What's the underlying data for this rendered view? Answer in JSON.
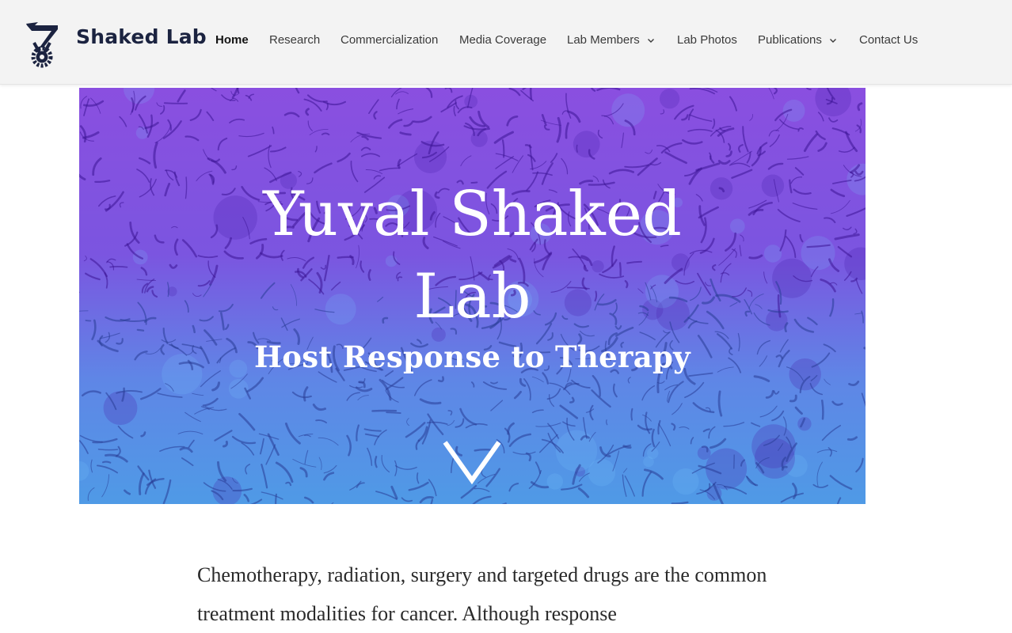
{
  "header": {
    "site_title": "Shaked Lab",
    "logo_icon": "technion-logo-icon"
  },
  "nav": {
    "items": [
      {
        "label": "Home",
        "active": true,
        "dropdown": false
      },
      {
        "label": "Research",
        "active": false,
        "dropdown": false
      },
      {
        "label": "Commercialization",
        "active": false,
        "dropdown": false
      },
      {
        "label": "Media Coverage",
        "active": false,
        "dropdown": false
      },
      {
        "label": "Lab Members",
        "active": false,
        "dropdown": true
      },
      {
        "label": "Lab Photos",
        "active": false,
        "dropdown": false
      },
      {
        "label": "Publications",
        "active": false,
        "dropdown": true
      },
      {
        "label": "Contact Us",
        "active": false,
        "dropdown": false
      }
    ]
  },
  "hero": {
    "title_line1": "Yuval Shaked",
    "title_line2": "Lab",
    "subtitle": "Host Response to Therapy",
    "scroll_icon": "chevron-down-icon"
  },
  "content": {
    "paragraph": "Chemotherapy, radiation, surgery and targeted drugs are the common treatment modalities for cancer. Although response"
  },
  "colors": {
    "header_bg": "#f3f3f3",
    "title_color": "#1b2340",
    "hero_top": "#8a4fe0",
    "hero_bottom": "#4f9ae6"
  }
}
